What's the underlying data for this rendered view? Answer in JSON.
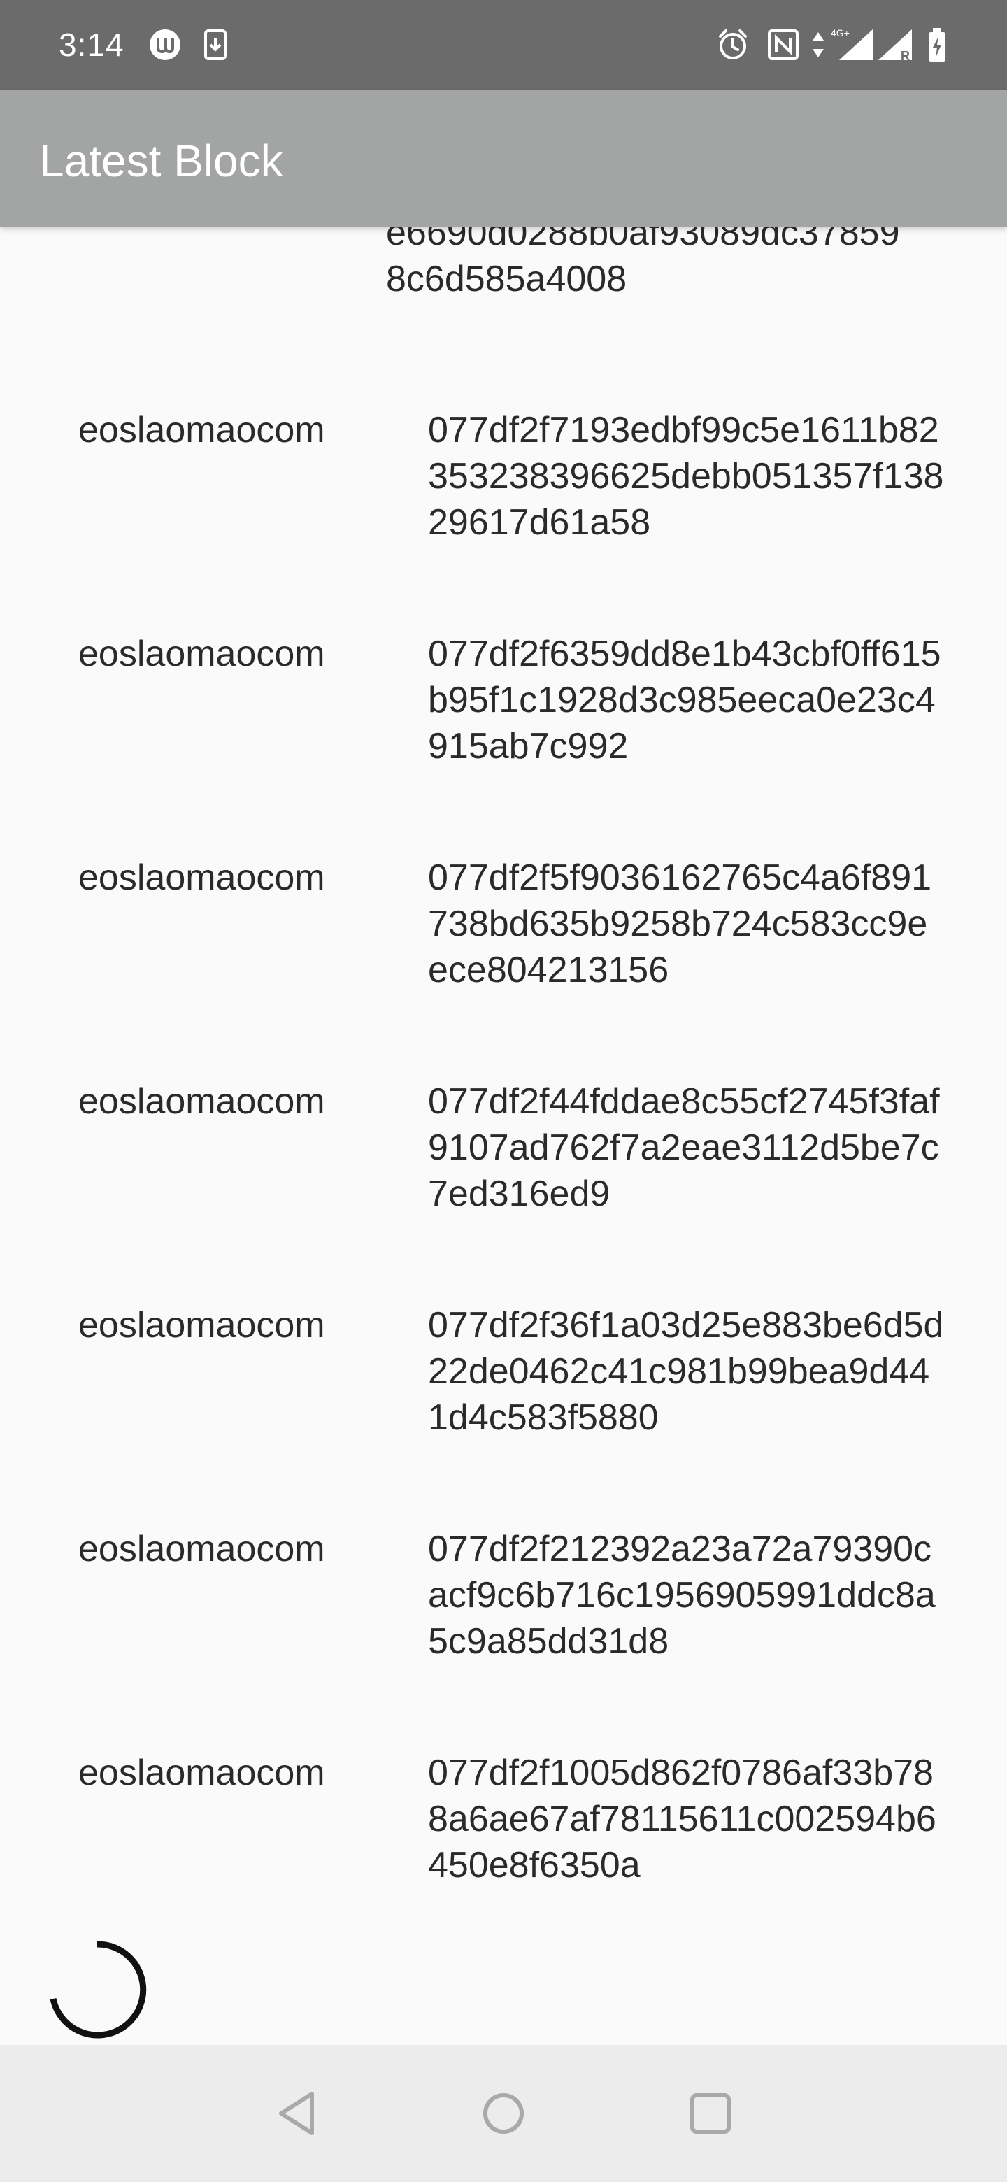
{
  "status_bar": {
    "time": "3:14",
    "icons": [
      "app-notification-icon",
      "download-icon",
      "alarm-icon",
      "nfc-icon",
      "data-arrows-icon",
      "signal-4g-icon",
      "signal-roaming-icon",
      "battery-charging-icon"
    ],
    "network_label": "4G+",
    "roaming_label": "R"
  },
  "app_bar": {
    "title": "Latest Block"
  },
  "blocks": {
    "partial": {
      "id": "e6690d0288b0af93089dc378598c6d585a4008"
    },
    "items": [
      {
        "producer": "eoslaomaocom",
        "id": "077df2f7193edbf99c5e1611b82353238396625debb051357f13829617d61a58"
      },
      {
        "producer": "eoslaomaocom",
        "id": "077df2f6359dd8e1b43cbf0ff615b95f1c1928d3c985eeca0e23c4915ab7c992"
      },
      {
        "producer": "eoslaomaocom",
        "id": "077df2f5f9036162765c4a6f891738bd635b9258b724c583cc9eece804213156"
      },
      {
        "producer": "eoslaomaocom",
        "id": "077df2f44fddae8c55cf2745f3faf9107ad762f7a2eae3112d5be7c7ed316ed9"
      },
      {
        "producer": "eoslaomaocom",
        "id": "077df2f36f1a03d25e883be6d5d22de0462c41c981b99bea9d441d4c583f5880"
      },
      {
        "producer": "eoslaomaocom",
        "id": "077df2f212392a23a72a79390cacf9c6b716c1956905991ddc8a5c9a85dd31d8"
      },
      {
        "producer": "eoslaomaocom",
        "id": "077df2f1005d862f0786af33b788a6ae67af78115611c002594b6450e8f6350a"
      }
    ]
  },
  "loading": {
    "icon": "loading-spinner-icon"
  },
  "nav_bar": {
    "buttons": [
      "back-icon",
      "home-icon",
      "recents-icon"
    ]
  },
  "colors": {
    "status_bar": "#6b6b6b",
    "app_bar": "#a2a5a4",
    "background": "#fafafa",
    "nav_bar": "#ececec",
    "text": "#2a2a2a",
    "nav_icon": "#a9a9a9"
  }
}
